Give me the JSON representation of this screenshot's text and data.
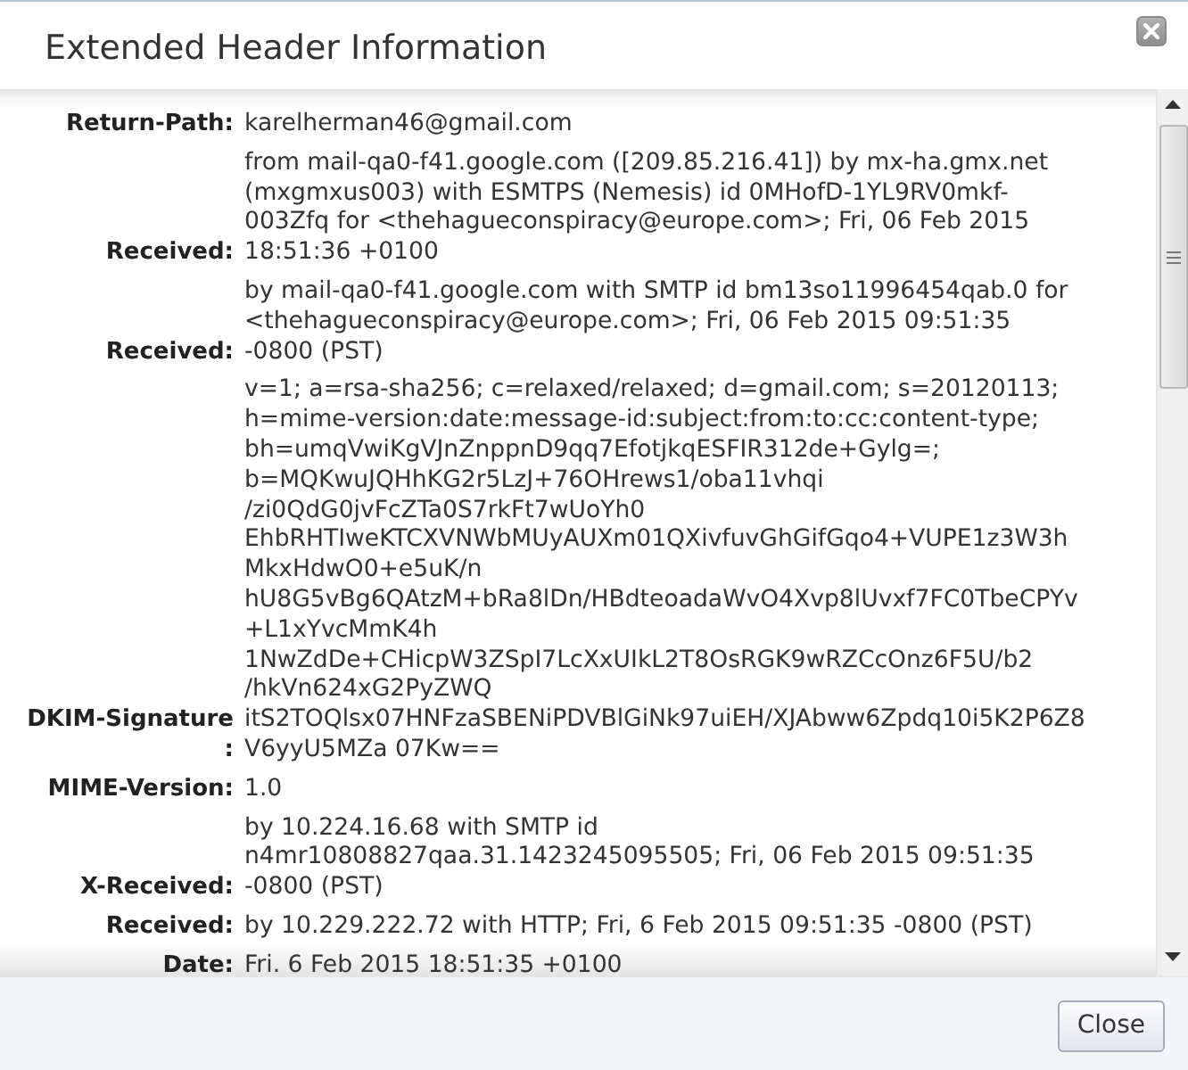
{
  "dialog": {
    "title": "Extended Header Information"
  },
  "headers": [
    {
      "name": "Return-Path:",
      "lines": [
        "karelherman46@gmail.com"
      ]
    },
    {
      "name": "Received:",
      "lines": [
        "from mail-qa0-f41.google.com ([209.85.216.41]) by mx-ha.gmx.net",
        "(mxgmxus003) with ESMTPS (Nemesis) id 0MHofD-1YL9RV0mkf-",
        "003Zfq for <thehagueconspiracy@europe.com>; Fri, 06 Feb 2015",
        "18:51:36 +0100"
      ]
    },
    {
      "name": "Received:",
      "lines": [
        "by mail-qa0-f41.google.com with SMTP id bm13so11996454qab.0 for",
        "<thehagueconspiracy@europe.com>; Fri, 06 Feb 2015 09:51:35",
        "-0800 (PST)"
      ]
    },
    {
      "name": "DKIM-Signature:",
      "lines": [
        "v=1; a=rsa-sha256; c=relaxed/relaxed; d=gmail.com; s=20120113;",
        "h=mime-version:date:message-id:subject:from:to:cc:content-type;",
        "bh=umqVwiKgVJnZnppnD9qq7EfotjkqESFIR312de+Gylg=;",
        "b=MQKwuJQHhKG2r5LzJ+76OHrews1/oba11vhqi",
        "/zi0QdG0jvFcZTa0S7rkFt7wUoYh0",
        "EhbRHTIweKTCXVNWbMUyAUXm01QXivfuvGhGifGqo4+VUPE1z3W3h",
        "MkxHdwO0+e5uK/n",
        "hU8G5vBg6QAtzM+bRa8lDn/HBdteoadaWvO4Xvp8lUvxf7FC0TbeCPYv",
        "+L1xYvcMmK4h",
        "1NwZdDe+CHicpW3ZSpI7LcXxUIkL2T8OsRGK9wRZCcOnz6F5U/b2",
        "/hkVn624xG2PyZWQ",
        "itS2TOQlsx07HNFzaSBENiPDVBlGiNk97uiEH/XJAbww6Zpdq10i5K2P6Z8",
        "V6yyU5MZa 07Kw=="
      ]
    },
    {
      "name": "MIME-Version:",
      "lines": [
        "1.0"
      ]
    },
    {
      "name": "X-Received:",
      "lines": [
        "by 10.224.16.68 with SMTP id",
        "n4mr10808827qaa.31.1423245095505; Fri, 06 Feb 2015 09:51:35",
        "-0800 (PST)"
      ]
    },
    {
      "name": "Received:",
      "lines": [
        "by 10.229.222.72 with HTTP; Fri, 6 Feb 2015 09:51:35 -0800 (PST)"
      ]
    },
    {
      "name": "Date:",
      "lines": [
        "Fri. 6 Feb 2015 18:51:35 +0100"
      ]
    }
  ],
  "buttons": [
    {
      "label": "Close"
    }
  ]
}
